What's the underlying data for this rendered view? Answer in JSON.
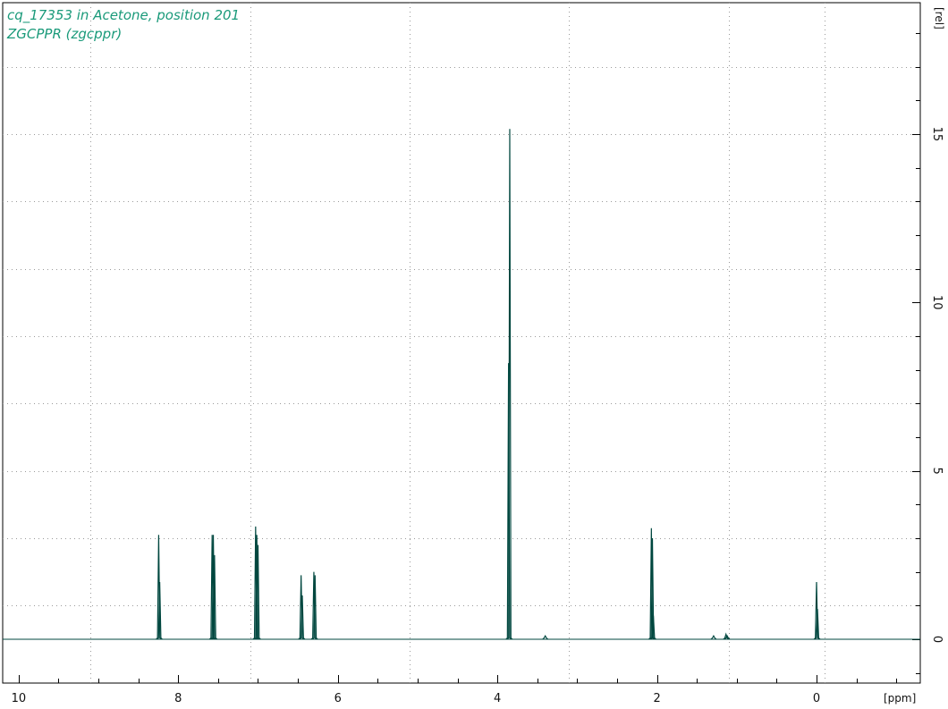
{
  "chart_data": {
    "type": "line",
    "title": "cq_17353 in Acetone, position 201",
    "subtitle": "ZGCPPR (zgcppr)",
    "xlabel": "[ppm]",
    "ylabel": "[rel]",
    "x_reversed": true,
    "xlim": [
      10.2,
      -1.3
    ],
    "ylim": [
      -1.3,
      18.9
    ],
    "x_ticks": [
      10,
      8,
      6,
      4,
      2,
      0
    ],
    "y_ticks": [
      0,
      5,
      10,
      15
    ],
    "x_grid": [
      9.1,
      7.1,
      5.1,
      3.1,
      1.1,
      -0.1
    ],
    "y_grid": [
      1,
      3,
      5,
      7,
      9,
      11,
      13,
      15,
      17
    ],
    "grid": true,
    "colors": {
      "trace": "#00473f",
      "title": "#1a9a7a",
      "grid": "#9a9a9a"
    },
    "peaks": [
      {
        "ppm": 8.245,
        "height": 3.1
      },
      {
        "ppm": 8.232,
        "height": 1.7
      },
      {
        "ppm": 7.575,
        "height": 3.1
      },
      {
        "ppm": 7.56,
        "height": 3.1
      },
      {
        "ppm": 7.545,
        "height": 2.5
      },
      {
        "ppm": 7.03,
        "height": 3.35
      },
      {
        "ppm": 7.015,
        "height": 3.1
      },
      {
        "ppm": 7.0,
        "height": 2.8
      },
      {
        "ppm": 6.46,
        "height": 1.9
      },
      {
        "ppm": 6.445,
        "height": 1.3
      },
      {
        "ppm": 6.3,
        "height": 2.0
      },
      {
        "ppm": 6.285,
        "height": 1.9
      },
      {
        "ppm": 3.845,
        "height": 15.15
      },
      {
        "ppm": 3.86,
        "height": 8.2
      },
      {
        "ppm": 3.4,
        "height": 0.1
      },
      {
        "ppm": 2.07,
        "height": 3.3
      },
      {
        "ppm": 2.057,
        "height": 3.0
      },
      {
        "ppm": 2.045,
        "height": 0.7
      },
      {
        "ppm": 1.29,
        "height": 0.1
      },
      {
        "ppm": 1.135,
        "height": 0.15
      },
      {
        "ppm": 1.12,
        "height": 0.1
      },
      {
        "ppm": 0.0,
        "height": 1.7
      },
      {
        "ppm": -0.012,
        "height": 0.9
      }
    ]
  }
}
